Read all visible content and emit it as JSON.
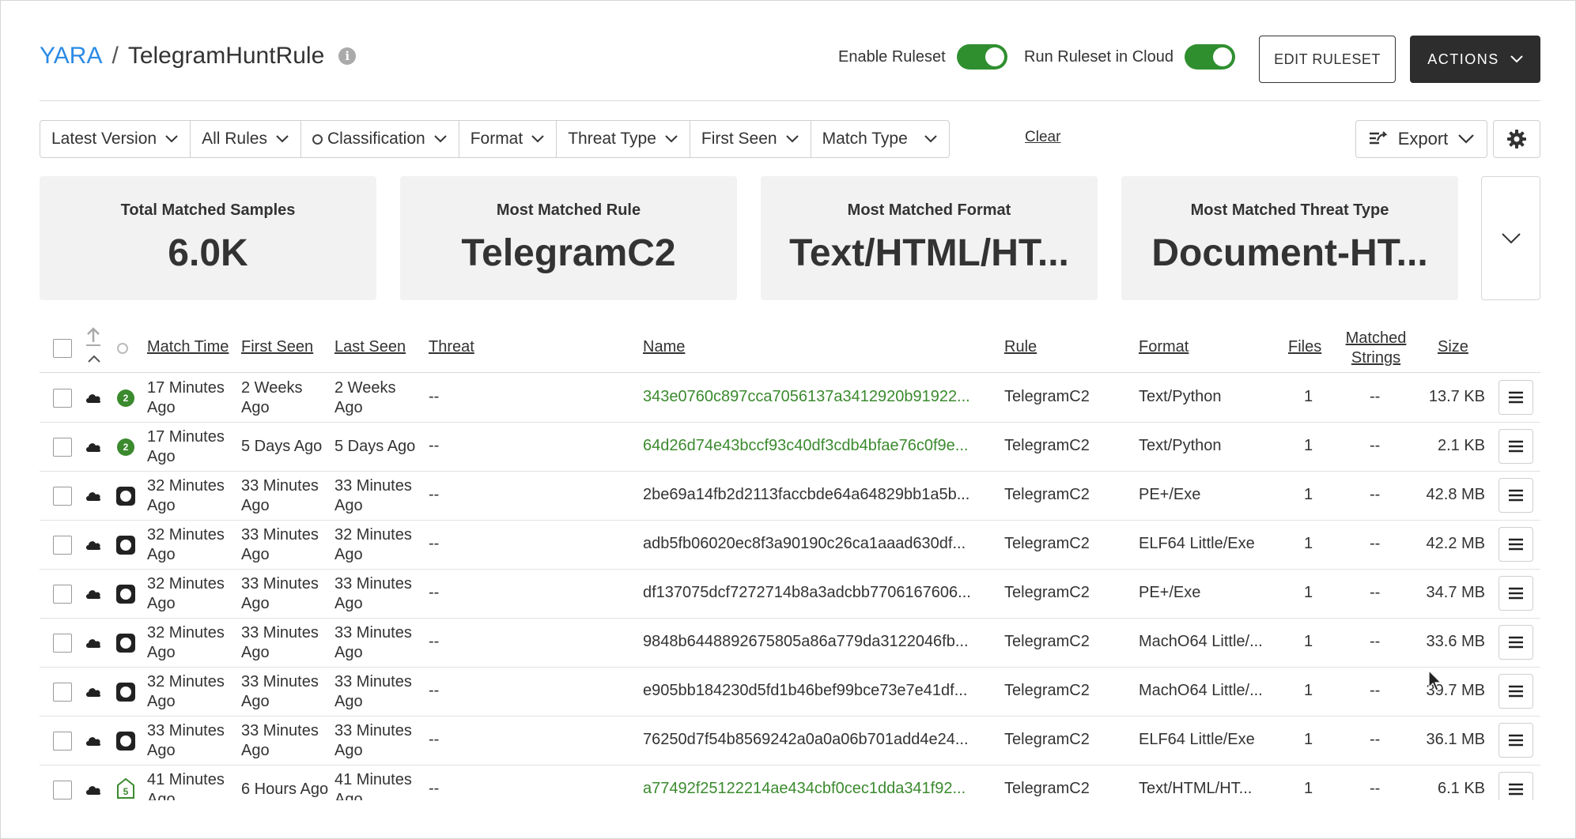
{
  "breadcrumb": {
    "root": "YARA",
    "separator": "/",
    "current": "TelegramHuntRule"
  },
  "header": {
    "enable_ruleset_label": "Enable Ruleset",
    "enable_ruleset_on": true,
    "run_cloud_label": "Run Ruleset in Cloud",
    "run_cloud_on": true,
    "edit_button": "EDIT RULESET",
    "actions_button": "ACTIONS"
  },
  "filters": {
    "latest_version": "Latest Version",
    "all_rules": "All Rules",
    "classification": "Classification",
    "format": "Format",
    "threat_type": "Threat Type",
    "first_seen": "First Seen",
    "match_type": "Match Type",
    "clear": "Clear",
    "export": "Export"
  },
  "stats": [
    {
      "label": "Total Matched Samples",
      "value": "6.0K"
    },
    {
      "label": "Most Matched Rule",
      "value": "TelegramC2"
    },
    {
      "label": "Most Matched Format",
      "value": "Text/HTML/HT..."
    },
    {
      "label": "Most Matched Threat Type",
      "value": "Document-HT..."
    }
  ],
  "table": {
    "columns": {
      "match_time": "Match Time",
      "first_seen": "First Seen",
      "last_seen": "Last Seen",
      "threat": "Threat",
      "name": "Name",
      "rule": "Rule",
      "format": "Format",
      "files": "Files",
      "matched_strings_1": "Matched",
      "matched_strings_2": "Strings",
      "size": "Size"
    },
    "rows": [
      {
        "badge": "2",
        "badge_type": "green",
        "match_time": [
          "17 Minutes",
          "Ago"
        ],
        "first_seen": [
          "2 Weeks",
          "Ago"
        ],
        "last_seen": [
          "2 Weeks",
          "Ago"
        ],
        "threat": "--",
        "name": "343e0760c897cca7056137a3412920b91922...",
        "name_green": true,
        "rule": "TelegramC2",
        "format": "Text/Python",
        "files": "1",
        "matched": "--",
        "size": "13.7 KB"
      },
      {
        "badge": "2",
        "badge_type": "green",
        "match_time": [
          "17 Minutes",
          "Ago"
        ],
        "first_seen": [
          "5 Days Ago",
          ""
        ],
        "last_seen": [
          "5 Days Ago",
          ""
        ],
        "threat": "--",
        "name": "64d26d74e43bccf93c40df3cdb4bfae76c0f9e...",
        "name_green": true,
        "rule": "TelegramC2",
        "format": "Text/Python",
        "files": "1",
        "matched": "--",
        "size": "2.1 KB"
      },
      {
        "badge": "",
        "badge_type": "dark",
        "match_time": [
          "32 Minutes",
          "Ago"
        ],
        "first_seen": [
          "33 Minutes",
          "Ago"
        ],
        "last_seen": [
          "33 Minutes",
          "Ago"
        ],
        "threat": "--",
        "name": "2be69a14fb2d2113faccbde64a64829bb1a5b...",
        "name_green": false,
        "rule": "TelegramC2",
        "format": "PE+/Exe",
        "files": "1",
        "matched": "--",
        "size": "42.8 MB"
      },
      {
        "badge": "",
        "badge_type": "dark",
        "match_time": [
          "32 Minutes",
          "Ago"
        ],
        "first_seen": [
          "33 Minutes",
          "Ago"
        ],
        "last_seen": [
          "32 Minutes",
          "Ago"
        ],
        "threat": "--",
        "name": "adb5fb06020ec8f3a90190c26ca1aaad630df...",
        "name_green": false,
        "rule": "TelegramC2",
        "format": "ELF64 Little/Exe",
        "files": "1",
        "matched": "--",
        "size": "42.2 MB"
      },
      {
        "badge": "",
        "badge_type": "dark",
        "match_time": [
          "32 Minutes",
          "Ago"
        ],
        "first_seen": [
          "33 Minutes",
          "Ago"
        ],
        "last_seen": [
          "33 Minutes",
          "Ago"
        ],
        "threat": "--",
        "name": "df137075dcf7272714b8a3adcbb7706167606...",
        "name_green": false,
        "rule": "TelegramC2",
        "format": "PE+/Exe",
        "files": "1",
        "matched": "--",
        "size": "34.7 MB"
      },
      {
        "badge": "",
        "badge_type": "dark",
        "match_time": [
          "32 Minutes",
          "Ago"
        ],
        "first_seen": [
          "33 Minutes",
          "Ago"
        ],
        "last_seen": [
          "33 Minutes",
          "Ago"
        ],
        "threat": "--",
        "name": "9848b6448892675805a86a779da3122046fb...",
        "name_green": false,
        "rule": "TelegramC2",
        "format": "MachO64 Little/...",
        "files": "1",
        "matched": "--",
        "size": "33.6 MB"
      },
      {
        "badge": "",
        "badge_type": "dark",
        "match_time": [
          "32 Minutes",
          "Ago"
        ],
        "first_seen": [
          "33 Minutes",
          "Ago"
        ],
        "last_seen": [
          "33 Minutes",
          "Ago"
        ],
        "threat": "--",
        "name": "e905bb184230d5fd1b46bef99bce73e7e41df...",
        "name_green": false,
        "rule": "TelegramC2",
        "format": "MachO64 Little/...",
        "files": "1",
        "matched": "--",
        "size": "39.7 MB"
      },
      {
        "badge": "",
        "badge_type": "dark",
        "match_time": [
          "33 Minutes",
          "Ago"
        ],
        "first_seen": [
          "33 Minutes",
          "Ago"
        ],
        "last_seen": [
          "33 Minutes",
          "Ago"
        ],
        "threat": "--",
        "name": "76250d7f54b8569242a0a0a06b701add4e24...",
        "name_green": false,
        "rule": "TelegramC2",
        "format": "ELF64 Little/Exe",
        "files": "1",
        "matched": "--",
        "size": "36.1 MB"
      },
      {
        "badge": "5",
        "badge_type": "green-outline",
        "match_time": [
          "41 Minutes",
          "Ago"
        ],
        "first_seen": [
          "6 Hours Ago",
          ""
        ],
        "last_seen": [
          "41 Minutes",
          "Ago"
        ],
        "threat": "--",
        "name": "a77492f25122214ae434cbf0cec1dda341f92...",
        "name_green": true,
        "rule": "TelegramC2",
        "format": "Text/HTML/HT...",
        "files": "1",
        "matched": "--",
        "size": "6.1 KB"
      }
    ]
  },
  "colors": {
    "accent_blue": "#2b8be6",
    "green": "#2f8f2f",
    "dark": "#2d2d2d"
  }
}
